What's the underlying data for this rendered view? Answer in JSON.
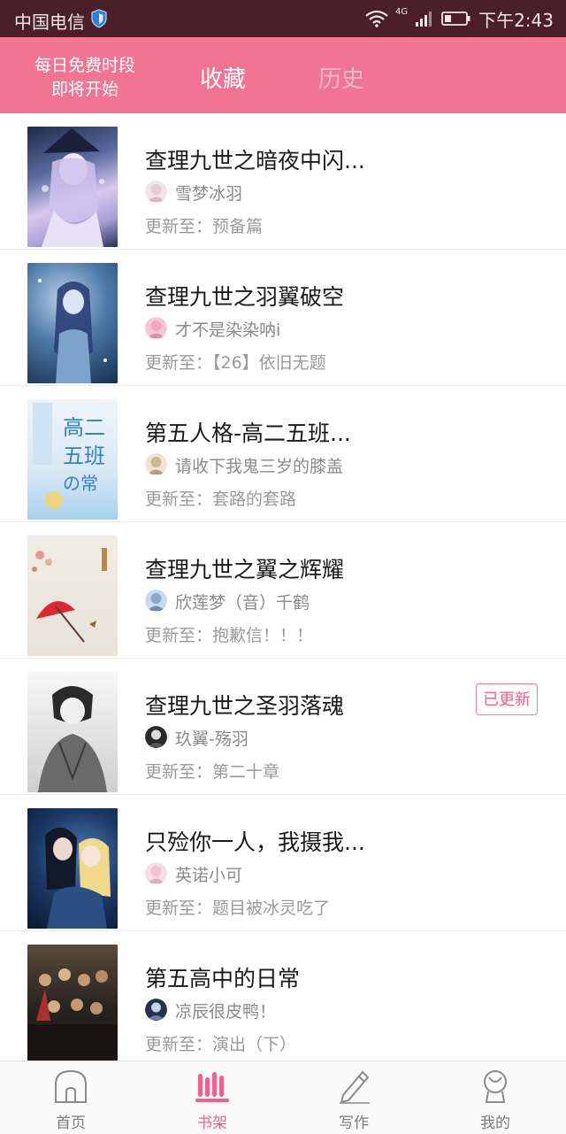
{
  "status_bar": {
    "carrier": "中国电信",
    "network": "4G",
    "time": "下午2:43"
  },
  "header": {
    "free_slot_line1": "每日免费时段",
    "free_slot_line2": "即将开始",
    "tab_favorites": "收藏",
    "tab_history": "历史",
    "active_tab": "收藏"
  },
  "books": [
    {
      "title": "查理九世之暗夜中闪...",
      "author": "雪梦冰羽",
      "update": "更新至：预备篇"
    },
    {
      "title": "查理九世之羽翼破空",
      "author": "才不是染染呐i",
      "update": "更新至：【26】依旧无题"
    },
    {
      "title": "第五人格-高二五班...",
      "author": "请收下我鬼三岁的膝盖",
      "update": "更新至：套路的套路",
      "cover_text": "高二五班の日常"
    },
    {
      "title": "查理九世之翼之辉耀",
      "author": "欣莲梦（音）千鹤",
      "update": "更新至：抱歉信！！！"
    },
    {
      "title": "查理九世之圣羽落魂",
      "author": "玖翼-殇羽",
      "update": "更新至：第二十章",
      "badge": "已更新"
    },
    {
      "title": "只殓你一人，我摄我...",
      "author": "英诺小可",
      "update": "更新至：题目被冰灵吃了"
    },
    {
      "title": "第五高中的日常",
      "author": "凉辰很皮鸭！",
      "update": "更新至：演出（下）"
    }
  ],
  "bottom_nav": {
    "home": "首页",
    "shelf": "书架",
    "write": "写作",
    "mine": "我的",
    "active": "书架"
  },
  "colors": {
    "header_bg": "#f17590",
    "accent": "#f06087",
    "status_bar_bg": "#4a1f27"
  }
}
